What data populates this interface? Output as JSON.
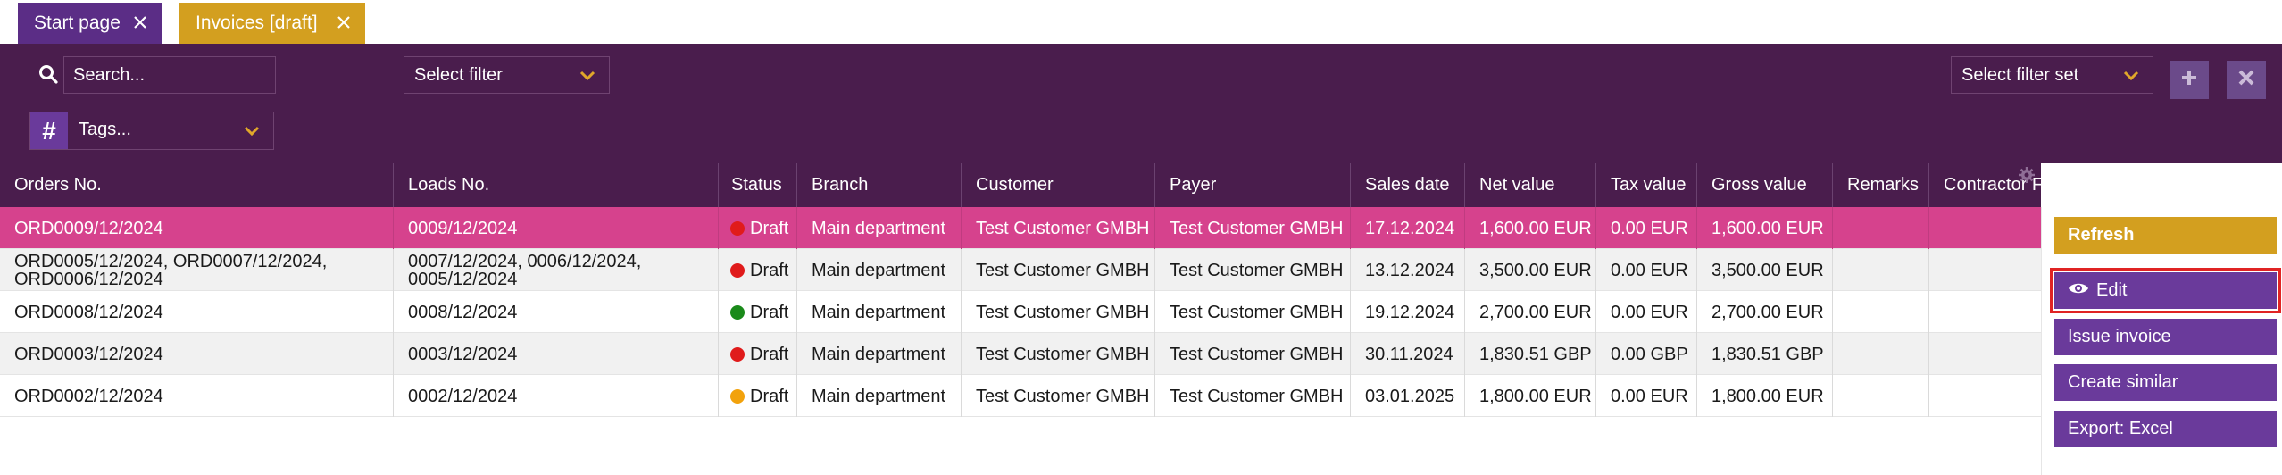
{
  "tabs": [
    {
      "label": "Start page"
    },
    {
      "label": "Invoices [draft]"
    }
  ],
  "filters": {
    "search_placeholder": "Search...",
    "select_filter": "Select filter",
    "select_filter_set": "Select filter set",
    "tags_placeholder": "Tags...",
    "tags_hash": "#"
  },
  "table": {
    "columns": [
      "Orders No.",
      "Loads No.",
      "Status",
      "Branch",
      "Customer",
      "Payer",
      "Sales date",
      "Net value",
      "Tax value",
      "Gross value",
      "Remarks",
      "Contractor F..."
    ],
    "rows": [
      {
        "orders": "ORD0009/12/2024",
        "loads": "0009/12/2024",
        "status": "Draft",
        "status_color": "#e01b1b",
        "branch": "Main department",
        "customer": "Test Customer GMBH",
        "payer": "Test Customer GMBH",
        "sales_date": "17.12.2024",
        "net": "1,600.00 EUR",
        "tax": "0.00 EUR",
        "gross": "1,600.00 EUR",
        "remarks": "",
        "contractor": ""
      },
      {
        "orders": "ORD0005/12/2024, ORD0007/12/2024, ORD0006/12/2024",
        "loads": "0007/12/2024, 0006/12/2024, 0005/12/2024",
        "status": "Draft",
        "status_color": "#e01b1b",
        "branch": "Main department",
        "customer": "Test Customer GMBH",
        "payer": "Test Customer GMBH",
        "sales_date": "13.12.2024",
        "net": "3,500.00 EUR",
        "tax": "0.00 EUR",
        "gross": "3,500.00 EUR",
        "remarks": "",
        "contractor": ""
      },
      {
        "orders": "ORD0008/12/2024",
        "loads": "0008/12/2024",
        "status": "Draft",
        "status_color": "#1a8a1a",
        "branch": "Main department",
        "customer": "Test Customer GMBH",
        "payer": "Test Customer GMBH",
        "sales_date": "19.12.2024",
        "net": "2,700.00 EUR",
        "tax": "0.00 EUR",
        "gross": "2,700.00 EUR",
        "remarks": "",
        "contractor": ""
      },
      {
        "orders": "ORD0003/12/2024",
        "loads": "0003/12/2024",
        "status": "Draft",
        "status_color": "#e01b1b",
        "branch": "Main department",
        "customer": "Test Customer GMBH",
        "payer": "Test Customer GMBH",
        "sales_date": "30.11.2024",
        "net": "1,830.51 GBP",
        "tax": "0.00 GBP",
        "gross": "1,830.51 GBP",
        "remarks": "",
        "contractor": ""
      },
      {
        "orders": "ORD0002/12/2024",
        "loads": "0002/12/2024",
        "status": "Draft",
        "status_color": "#f2a20c",
        "branch": "Main department",
        "customer": "Test Customer GMBH",
        "payer": "Test Customer GMBH",
        "sales_date": "03.01.2025",
        "net": "1,800.00 EUR",
        "tax": "0.00 EUR",
        "gross": "1,800.00 EUR",
        "remarks": "",
        "contractor": ""
      }
    ]
  },
  "actions": {
    "refresh": "Refresh",
    "edit": "Edit",
    "issue_invoice": "Issue invoice",
    "create_similar": "Create similar",
    "export_excel": "Export: Excel"
  },
  "colors": {
    "header_bg": "#4a1d4d",
    "accent_purple": "#6a3a9b",
    "accent_gold": "#d39f1f",
    "selected_row": "#d6428d",
    "highlight_border": "#e02424"
  }
}
